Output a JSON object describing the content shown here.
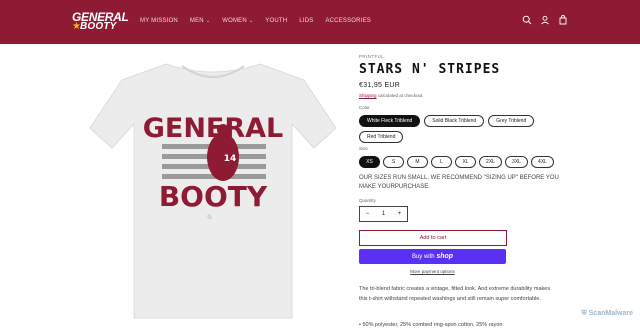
{
  "header": {
    "logo_line1": "GENERAL",
    "logo_line2": "BOOTY",
    "nav": [
      {
        "label": "MY MISSION",
        "dropdown": false
      },
      {
        "label": "MEN",
        "dropdown": true
      },
      {
        "label": "WOMEN",
        "dropdown": true
      },
      {
        "label": "YOUTH",
        "dropdown": false
      },
      {
        "label": "LIDS",
        "dropdown": false
      },
      {
        "label": "ACCESSORIES",
        "dropdown": false
      }
    ],
    "icons": [
      "search-icon",
      "account-icon",
      "cart-icon"
    ]
  },
  "product": {
    "vendor": "PRINTFUL",
    "title": "STARS N' STRIPES",
    "price": "€31,95 EUR",
    "shipping_link": "Shipping",
    "shipping_text": " calculated at checkout.",
    "color_label": "Color",
    "colors": [
      "White Fleck Triblend",
      "Solid Black Triblend",
      "Grey Triblend",
      "Red Triblend"
    ],
    "selected_color": "White Fleck Triblend",
    "size_label": "Size",
    "sizes": [
      "XS",
      "S",
      "M",
      "L",
      "XL",
      "2XL",
      "3XL",
      "4XL"
    ],
    "selected_size": "XS",
    "note": "OUR SIZES RUN SMALL. WE RECOMMEND \"SIZING UP\" BEFORE YOU MAKE YOURPURCHASE.",
    "quantity_label": "Quantity",
    "quantity": "1",
    "add_to_cart": "Add to cart",
    "buy_with": "Buy with",
    "shop_brand": "shop",
    "more_payment": "More payment options",
    "description": "The tri-blend fabric creates a vintage, fitted look. And extreme durability makes this t-shirt withstand repeated washings and still remain super comfortable.",
    "bullet": "• 50% polyester, 25% combed ring-spun cotton, 25% rayon",
    "shirt_graphic": {
      "line1": "GENERAL",
      "line2": "BOOTY",
      "jersey": "14"
    }
  },
  "watermark": "ScanMalware",
  "colors": {
    "brand": "#8e1a33",
    "shop": "#5a31f4",
    "accent": "#f2b705"
  }
}
